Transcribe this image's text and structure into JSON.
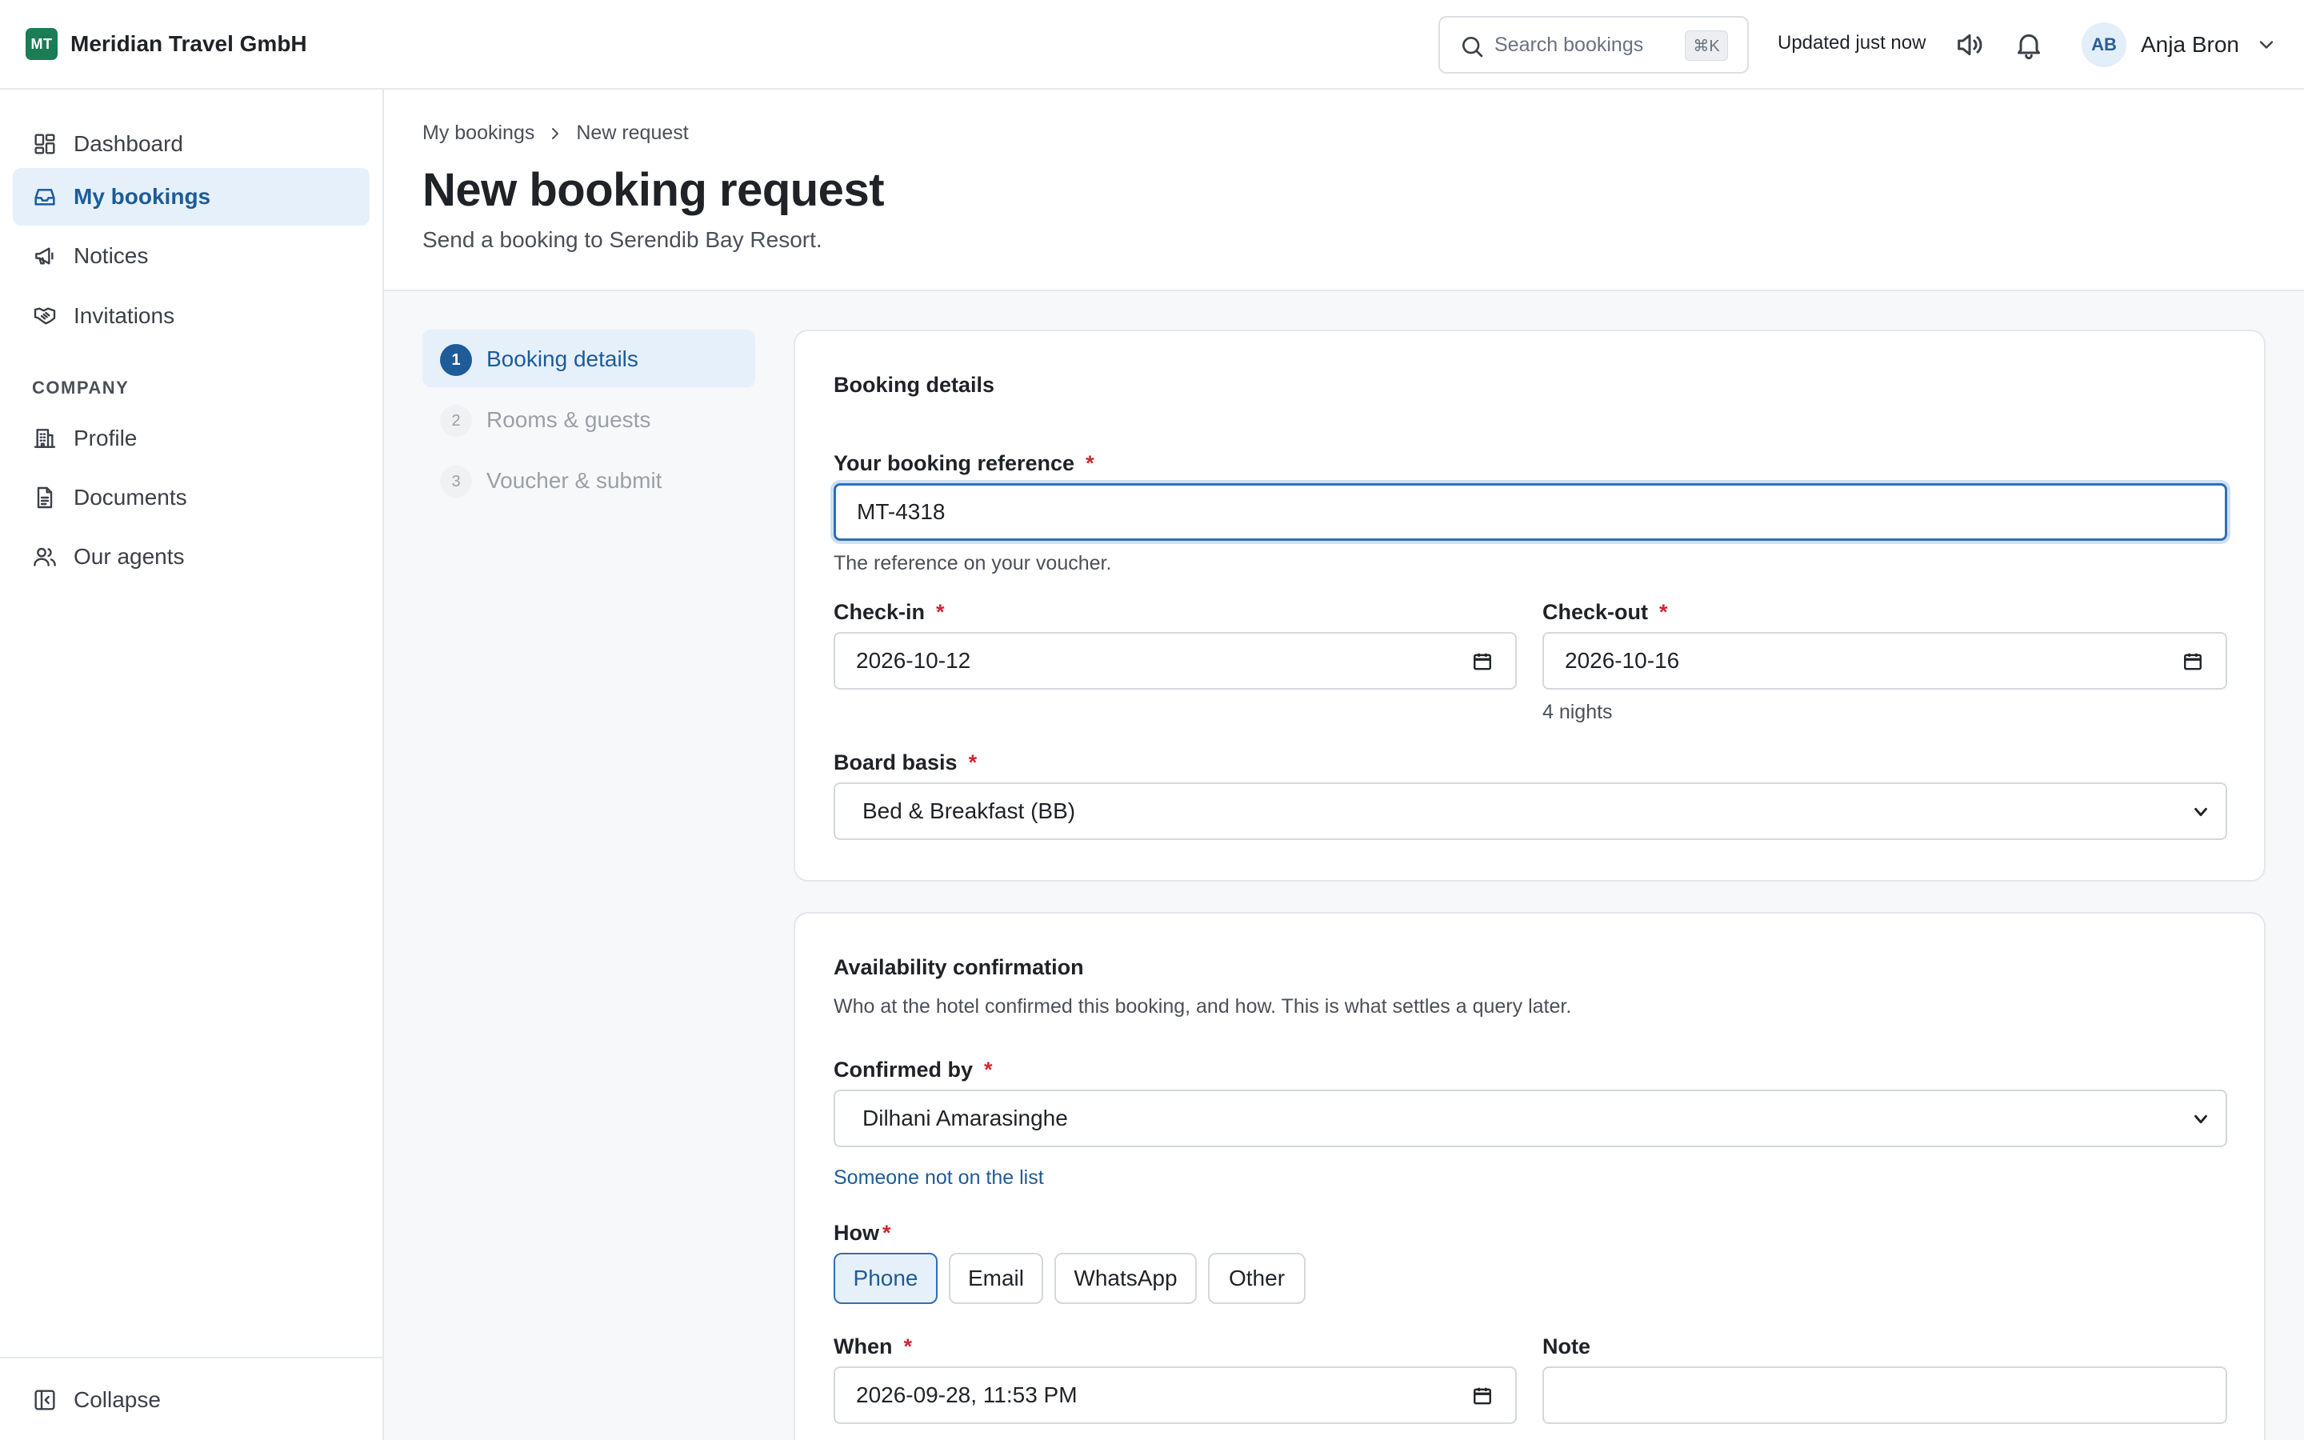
{
  "topbar": {
    "brand_initials": "MT",
    "brand_name": "Meridian Travel GmbH",
    "search_placeholder": "Search bookings",
    "search_shortcut": "⌘K",
    "updated": "Updated just now",
    "user_initials": "AB",
    "user_name": "Anja Bron"
  },
  "sidebar": {
    "items": [
      {
        "label": "Dashboard",
        "icon": "dashboard-icon"
      },
      {
        "label": "My bookings",
        "icon": "inbox-icon",
        "active": true
      },
      {
        "label": "Notices",
        "icon": "megaphone-icon"
      },
      {
        "label": "Invitations",
        "icon": "handshake-icon"
      }
    ],
    "section_label": "COMPANY",
    "company_items": [
      {
        "label": "Profile",
        "icon": "building-icon"
      },
      {
        "label": "Documents",
        "icon": "document-icon"
      },
      {
        "label": "Our agents",
        "icon": "users-icon"
      }
    ],
    "collapse_label": "Collapse"
  },
  "header": {
    "breadcrumb": [
      "My bookings",
      "New request"
    ],
    "title": "New booking request",
    "subtitle": "Send a booking to Serendib Bay Resort."
  },
  "steps": [
    {
      "num": "1",
      "label": "Booking details",
      "active": true
    },
    {
      "num": "2",
      "label": "Rooms & guests"
    },
    {
      "num": "3",
      "label": "Voucher & submit"
    }
  ],
  "booking": {
    "title": "Booking details",
    "reference_label": "Your booking reference",
    "reference_value": "MT-4318",
    "reference_hint": "The reference on your voucher.",
    "checkin_label": "Check-in",
    "checkin_value": "2026-10-12",
    "checkout_label": "Check-out",
    "checkout_value": "2026-10-16",
    "nights": "4 nights",
    "board_label": "Board basis",
    "board_value": "Bed & Breakfast (BB)"
  },
  "availability": {
    "title": "Availability confirmation",
    "desc": "Who at the hotel confirmed this booking, and how. This is what settles a query later.",
    "confirmed_label": "Confirmed by",
    "confirmed_value": "Dilhani Amarasinghe",
    "not_on_list": "Someone not on the list",
    "how_label": "How",
    "how_options": [
      "Phone",
      "Email",
      "WhatsApp",
      "Other"
    ],
    "how_selected": "Phone",
    "when_label": "When",
    "when_value": "2026-09-28, 11:53 PM",
    "note_label": "Note"
  },
  "colors": {
    "brand": "#1a7d56",
    "accent": "#1d5c99",
    "active_bg": "#e6f0fb",
    "required": "#d1242f"
  }
}
